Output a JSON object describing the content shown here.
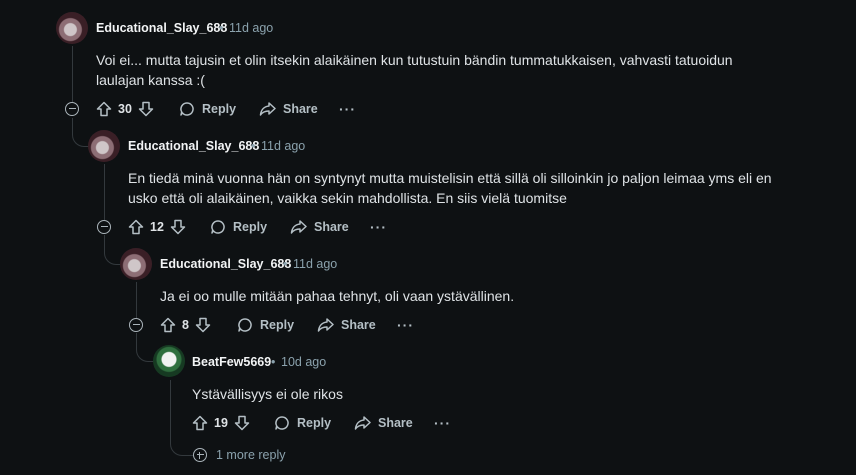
{
  "comments": [
    {
      "username": "Educational_Slay_688",
      "time": "11d ago",
      "text": "Voi ei... mutta tajusin et olin itsekin alaikäinen kun tutustuin bändin tummatukkaisen, vahvasti tatuoidun laulajan kanssa :(",
      "votes": "30",
      "avatar": "cat-avatar"
    },
    {
      "username": "Educational_Slay_688",
      "time": "11d ago",
      "text": "En tiedä minä vuonna hän on syntynyt mutta muistelisin että sillä oli silloinkin jo paljon leimaa yms eli en usko että oli alaikäinen, vaikka sekin mahdollista. En siis vielä tuomitse",
      "votes": "12",
      "avatar": "cat-avatar"
    },
    {
      "username": "Educational_Slay_688",
      "time": "11d ago",
      "text": "Ja ei oo mulle mitään pahaa tehnyt, oli vaan ystävällinen.",
      "votes": "8",
      "avatar": "cat-avatar"
    },
    {
      "username": "BeatFew5669",
      "time": "10d ago",
      "text": "Ystävällisyys ei ole rikos",
      "votes": "19",
      "avatar": "snoo-avatar"
    }
  ],
  "labels": {
    "reply": "Reply",
    "share": "Share",
    "more": "···",
    "separator": "•",
    "more_replies": "1 more reply"
  }
}
